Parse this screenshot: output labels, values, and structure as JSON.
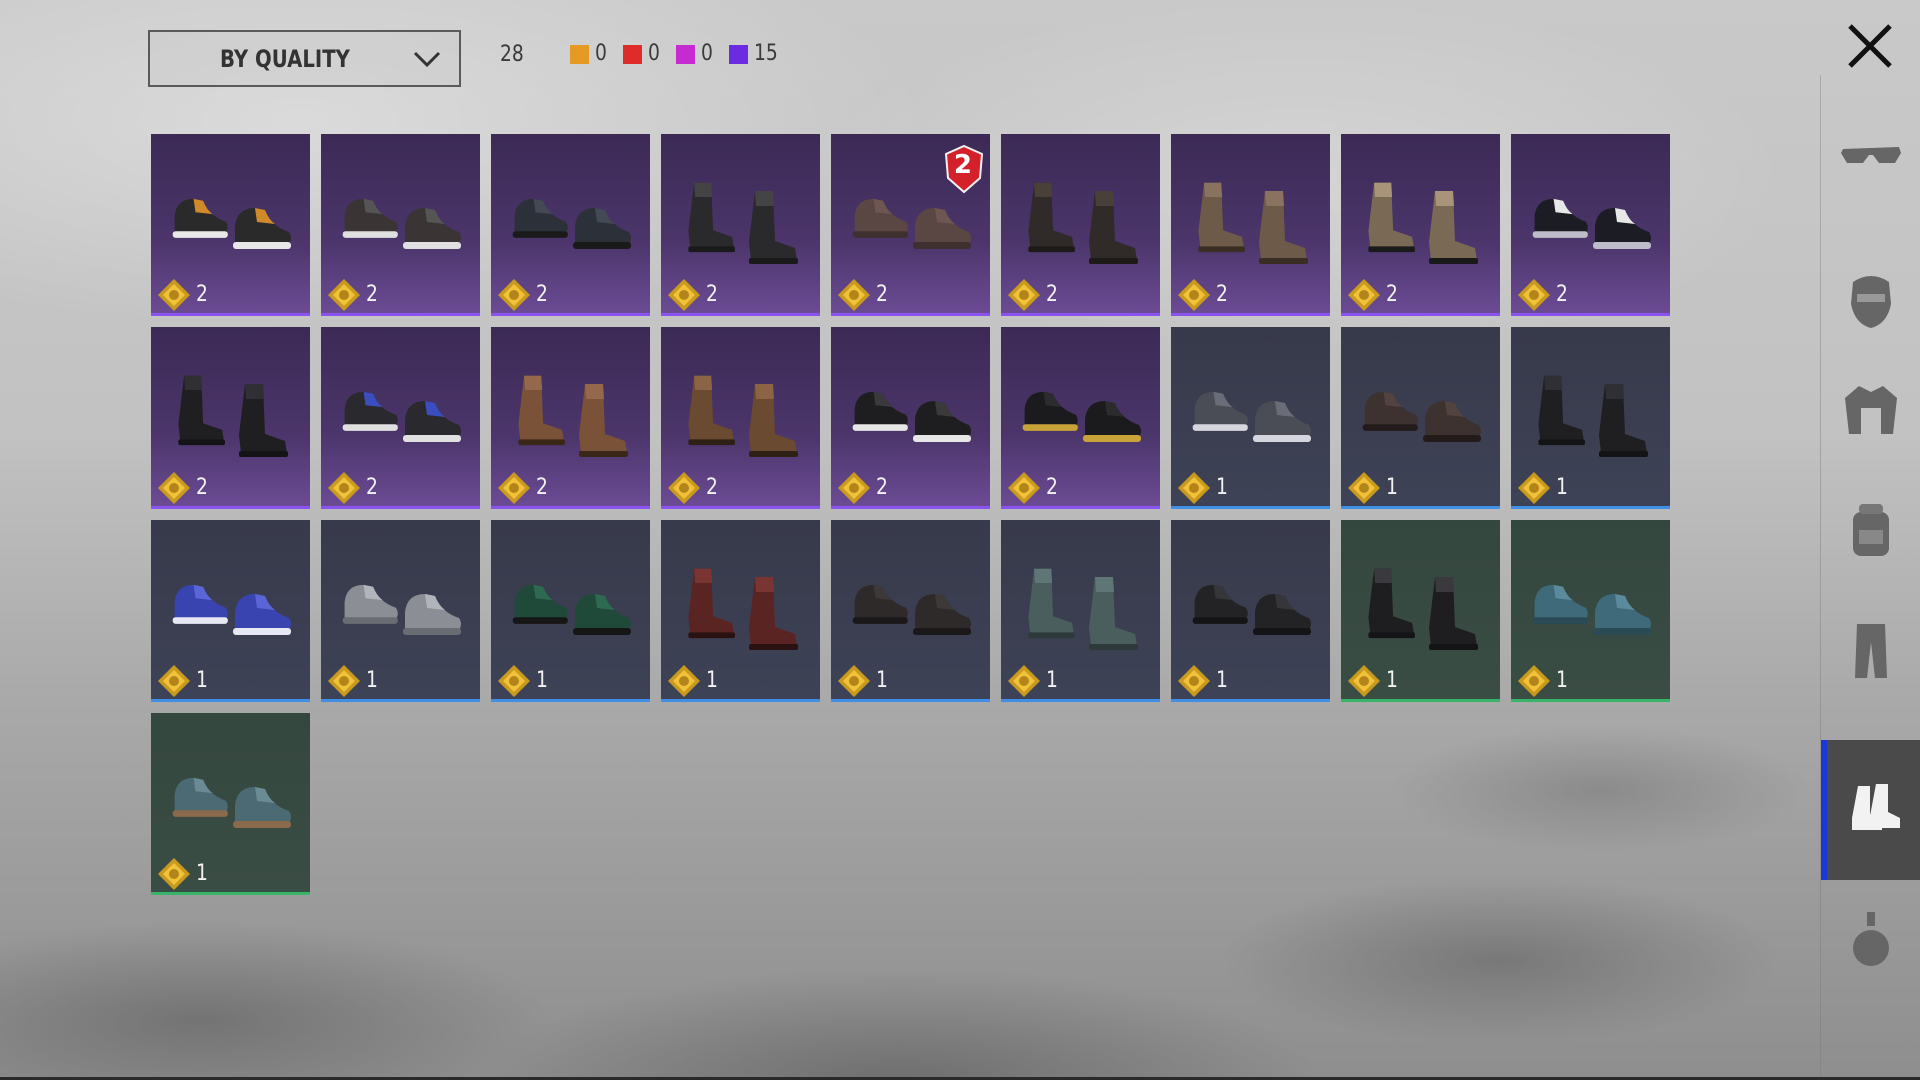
{
  "header": {
    "sort_label": "BY QUALITY",
    "total": "28",
    "rarities": [
      {
        "color": "#e59a24",
        "count": "0"
      },
      {
        "color": "#e02b2b",
        "count": "0"
      },
      {
        "color": "#c62ad1",
        "count": "0"
      },
      {
        "color": "#6b2be0",
        "count": "15"
      }
    ]
  },
  "items": [
    {
      "rarity": "purple",
      "qty": "2",
      "shoe": "sneaker-orange"
    },
    {
      "rarity": "purple",
      "qty": "2",
      "shoe": "hightop-dark"
    },
    {
      "rarity": "purple",
      "qty": "2",
      "shoe": "loafer-dark"
    },
    {
      "rarity": "purple",
      "qty": "2",
      "shoe": "boot-black"
    },
    {
      "rarity": "purple",
      "qty": "2",
      "shoe": "slipper-brown",
      "badge": "2"
    },
    {
      "rarity": "purple",
      "qty": "2",
      "shoe": "tall-boot-dark"
    },
    {
      "rarity": "purple",
      "qty": "2",
      "shoe": "boot-tan"
    },
    {
      "rarity": "purple",
      "qty": "2",
      "shoe": "boot-fur"
    },
    {
      "rarity": "purple",
      "qty": "2",
      "shoe": "sneaker-white"
    },
    {
      "rarity": "purple",
      "qty": "2",
      "shoe": "tall-boot-black"
    },
    {
      "rarity": "purple",
      "qty": "2",
      "shoe": "hightop-blue"
    },
    {
      "rarity": "purple",
      "qty": "2",
      "shoe": "boot-brown"
    },
    {
      "rarity": "purple",
      "qty": "2",
      "shoe": "boot-strap-brown"
    },
    {
      "rarity": "purple",
      "qty": "2",
      "shoe": "sneaker-black"
    },
    {
      "rarity": "purple",
      "qty": "2",
      "shoe": "sneaker-black-gold"
    },
    {
      "rarity": "blue",
      "qty": "1",
      "shoe": "sneaker-grey"
    },
    {
      "rarity": "blue",
      "qty": "1",
      "shoe": "dress-brown"
    },
    {
      "rarity": "blue",
      "qty": "1",
      "shoe": "tall-boot-black"
    },
    {
      "rarity": "blue",
      "qty": "1",
      "shoe": "sneaker-blue"
    },
    {
      "rarity": "blue",
      "qty": "1",
      "shoe": "slipon-grey"
    },
    {
      "rarity": "blue",
      "qty": "1",
      "shoe": "sneaker-green"
    },
    {
      "rarity": "blue",
      "qty": "1",
      "shoe": "boot-red"
    },
    {
      "rarity": "blue",
      "qty": "1",
      "shoe": "dress-dark"
    },
    {
      "rarity": "blue",
      "qty": "1",
      "shoe": "boot-teal"
    },
    {
      "rarity": "blue",
      "qty": "1",
      "shoe": "dress-black"
    },
    {
      "rarity": "green",
      "qty": "1",
      "shoe": "boot-buckle"
    },
    {
      "rarity": "green",
      "qty": "1",
      "shoe": "hightop-teal"
    },
    {
      "rarity": "green",
      "qty": "1",
      "shoe": "shoe-teal"
    }
  ],
  "sidebar": [
    {
      "icon": "glasses-icon"
    },
    {
      "icon": "mask-icon"
    },
    {
      "icon": "jacket-icon"
    },
    {
      "icon": "backpack-icon"
    },
    {
      "icon": "pants-icon"
    },
    {
      "icon": "shoes-icon",
      "active": true
    },
    {
      "icon": "bottle-icon"
    }
  ]
}
